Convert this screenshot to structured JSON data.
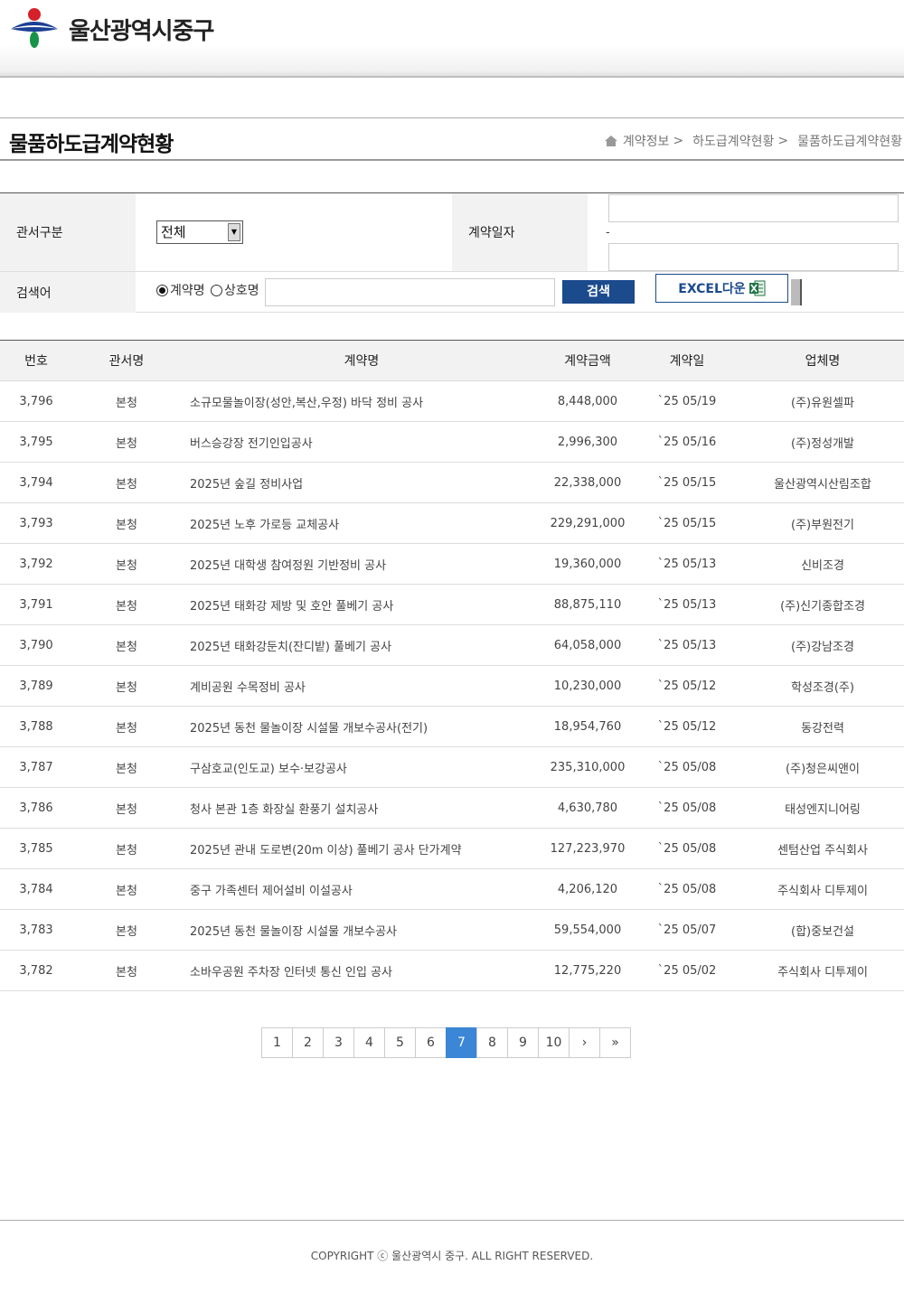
{
  "header": {
    "site_name": "울산광역시중구"
  },
  "page": {
    "title": "물품하도급계약현황",
    "breadcrumb": [
      "계약정보",
      "하도급계약현황",
      "물품하도급계약현황"
    ],
    "breadcrumb_sep": ">"
  },
  "search": {
    "office_label": "관서구분",
    "office_value": "전체",
    "date_label": "계약일자",
    "date_from": "",
    "date_to": "",
    "date_dash": "-",
    "keyword_label": "검색어",
    "radio_contract": "계약명",
    "radio_company": "상호명",
    "radio_selected": "계약명",
    "keyword_value": "",
    "search_button": "검색",
    "excel_button": "EXCEL다운"
  },
  "table": {
    "headers": [
      "번호",
      "관서명",
      "계약명",
      "계약금액",
      "계약일",
      "업체명"
    ],
    "rows": [
      [
        "3,796",
        "본청",
        "소규모물놀이장(성안,복산,우정) 바닥 정비 공사",
        "8,448,000",
        "`25 05/19",
        "(주)유원셀파"
      ],
      [
        "3,795",
        "본청",
        "버스승강장 전기인입공사",
        "2,996,300",
        "`25 05/16",
        "(주)정성개발"
      ],
      [
        "3,794",
        "본청",
        "2025년 숲길 정비사업",
        "22,338,000",
        "`25 05/15",
        "울산광역시산림조합"
      ],
      [
        "3,793",
        "본청",
        "2025년 노후 가로등 교체공사",
        "229,291,000",
        "`25 05/15",
        "(주)부원전기"
      ],
      [
        "3,792",
        "본청",
        "2025년 대학생 참여정원 기반정비 공사",
        "19,360,000",
        "`25 05/13",
        "신비조경"
      ],
      [
        "3,791",
        "본청",
        "2025년 태화강 제방 및 호안 풀베기 공사",
        "88,875,110",
        "`25 05/13",
        "(주)신기종합조경"
      ],
      [
        "3,790",
        "본청",
        "2025년 태화강둔치(잔디밭) 풀베기 공사",
        "64,058,000",
        "`25 05/13",
        "(주)강남조경"
      ],
      [
        "3,789",
        "본청",
        "계비공원 수목정비 공사",
        "10,230,000",
        "`25 05/12",
        "학성조경(주)"
      ],
      [
        "3,788",
        "본청",
        "2025년 동천 물놀이장 시설물 개보수공사(전기)",
        "18,954,760",
        "`25 05/12",
        "동강전력"
      ],
      [
        "3,787",
        "본청",
        "구삼호교(인도교) 보수·보강공사",
        "235,310,000",
        "`25 05/08",
        "(주)청은씨앤이"
      ],
      [
        "3,786",
        "본청",
        "청사 본관 1층 화장실 환풍기 설치공사",
        "4,630,780",
        "`25 05/08",
        "태성엔지니어링"
      ],
      [
        "3,785",
        "본청",
        "2025년 관내 도로변(20m 이상) 풀베기 공사 단가계약",
        "127,223,970",
        "`25 05/08",
        "센텀산업 주식회사"
      ],
      [
        "3,784",
        "본청",
        "중구 가족센터 제어설비 이설공사",
        "4,206,120",
        "`25 05/08",
        "주식회사 디투제이"
      ],
      [
        "3,783",
        "본청",
        "2025년 동천 물놀이장 시설물 개보수공사",
        "59,554,000",
        "`25 05/07",
        "(합)중보건설"
      ],
      [
        "3,782",
        "본청",
        "소바우공원 주차장 인터넷 통신 인입 공사",
        "12,775,220",
        "`25 05/02",
        "주식회사 디투제이"
      ]
    ]
  },
  "pagination": {
    "pages": [
      "1",
      "2",
      "3",
      "4",
      "5",
      "6",
      "7",
      "8",
      "9",
      "10"
    ],
    "current": "7",
    "next": "›",
    "last": "»"
  },
  "footer": {
    "copyright": "COPYRIGHT ⓒ 울산광역시 중구. ALL RIGHT RESERVED."
  },
  "colors": {
    "primary": "#1b4a8d",
    "active_page": "#3b86d6",
    "logo_red": "#d6202a",
    "logo_blue": "#1b3f94",
    "logo_green": "#159447"
  }
}
